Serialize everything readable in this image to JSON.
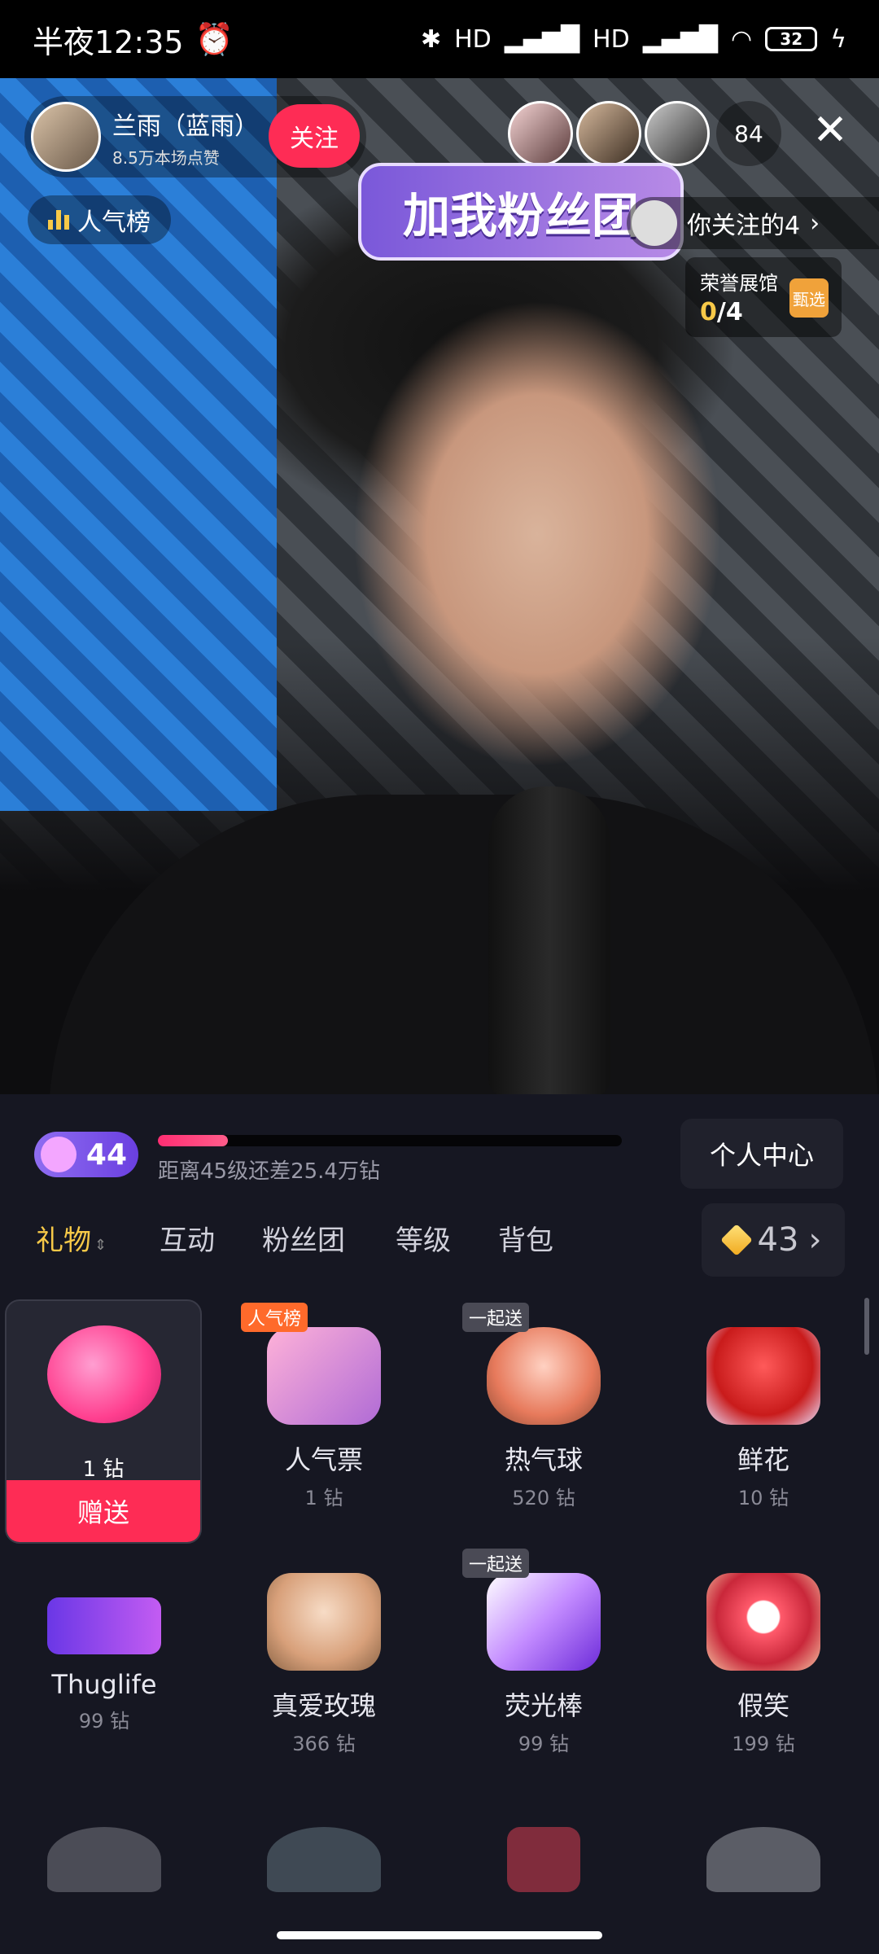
{
  "status_bar": {
    "time": "半夜12:35",
    "signal1": "HD",
    "signal2": "HD",
    "battery": "32"
  },
  "host": {
    "name": "兰雨（蓝雨）",
    "likes": "8.5万本场点赞",
    "follow_label": "关注"
  },
  "viewers": {
    "count": "84"
  },
  "popularity_label": "人气榜",
  "fanclub_banner": "加我粉丝团",
  "following_label": "你关注的4",
  "honor_hall": {
    "title": "荣誉展馆",
    "done": "0",
    "total": "/4",
    "icon_text": "甄选"
  },
  "level": {
    "value": "44",
    "progress_fraction": 0.15,
    "hint": "距离45级还差25.4万钻"
  },
  "personal_center": "个人中心",
  "tabs": [
    "礼物",
    "互动",
    "粉丝团",
    "等级",
    "背包"
  ],
  "balance": "43",
  "selected_gift": {
    "price": "1 钻",
    "send_label": "赠送"
  },
  "gifts": [
    {
      "name": "人气票",
      "price": "1 钻",
      "tag": "人气榜"
    },
    {
      "name": "热气球",
      "price": "520 钻",
      "tag": "一起送"
    },
    {
      "name": "鲜花",
      "price": "10 钻",
      "tag": ""
    },
    {
      "name": "Thuglife",
      "price": "99 钻",
      "tag": ""
    },
    {
      "name": "真爱玫瑰",
      "price": "366 钻",
      "tag": ""
    },
    {
      "name": "荧光棒",
      "price": "99 钻",
      "tag": "一起送"
    },
    {
      "name": "假笑",
      "price": "199 钻",
      "tag": ""
    }
  ],
  "colors": {
    "accent": "#fe2c55",
    "active_tab": "#f7c948",
    "panel_bg": "#161722"
  }
}
